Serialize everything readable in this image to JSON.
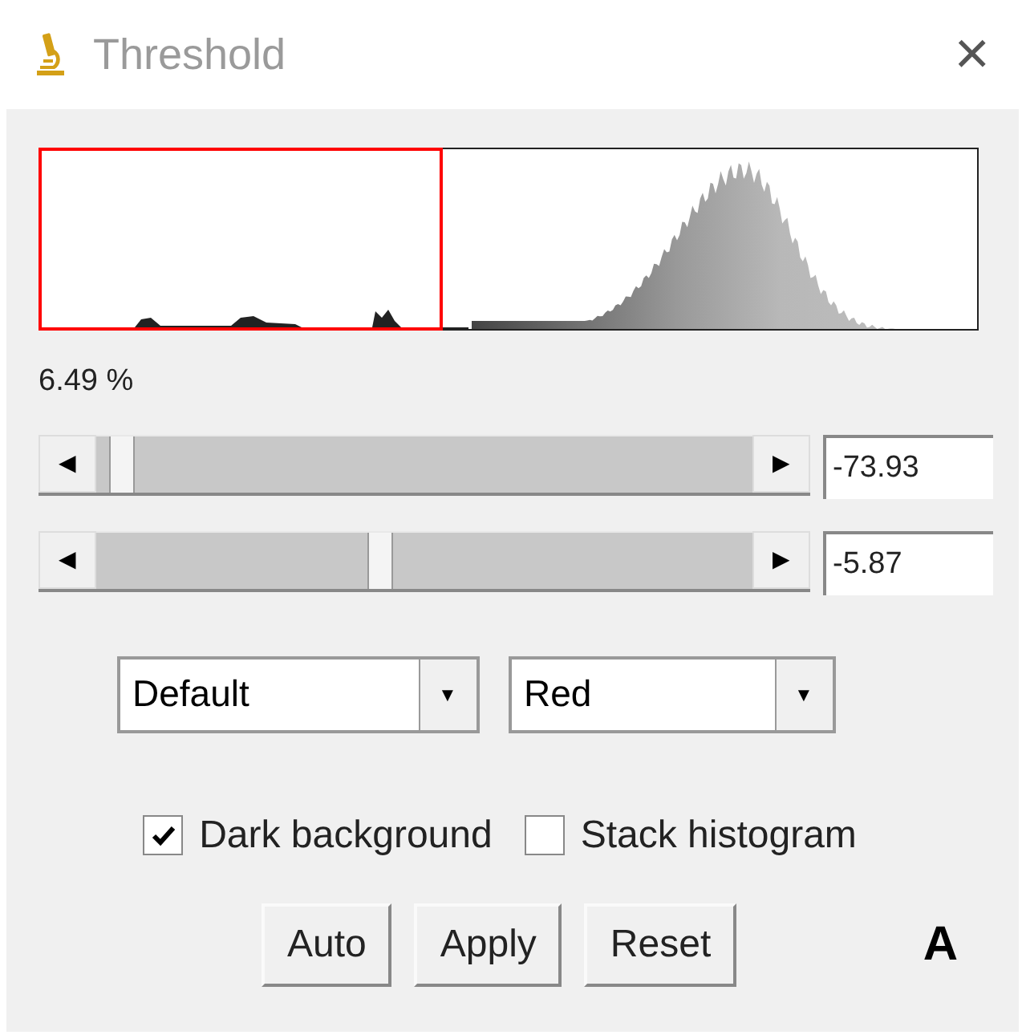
{
  "window": {
    "title": "Threshold",
    "close": "×"
  },
  "percentage": "6.49 %",
  "sliders": [
    {
      "level": 0.02,
      "value": "-73.93",
      "left": "◀",
      "right": "▶"
    },
    {
      "level": 0.43,
      "value": "-5.87",
      "left": "◀",
      "right": "▶"
    }
  ],
  "dropdowns": [
    {
      "value": "Default",
      "arrow": "▼"
    },
    {
      "value": "Red",
      "arrow": "▼"
    }
  ],
  "checkboxes": [
    {
      "label": "Dark background",
      "checked": true
    },
    {
      "label": "Stack histogram",
      "checked": false
    }
  ],
  "buttons": [
    "Auto",
    "Apply",
    "Reset"
  ],
  "panel_label": "A"
}
